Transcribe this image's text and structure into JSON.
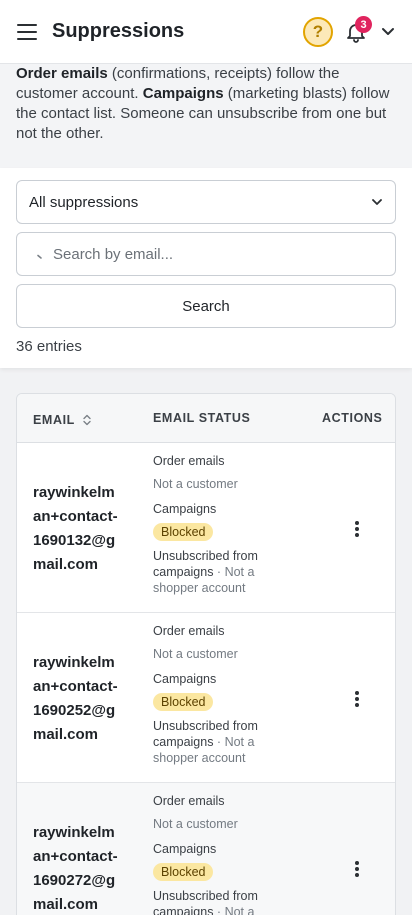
{
  "header": {
    "title": "Suppressions",
    "help_label": "?",
    "notification_count": "3",
    "icons": [
      "menu-icon",
      "help-icon",
      "bell-icon",
      "chevron-down-icon"
    ]
  },
  "intro": {
    "order_emails": "Order emails",
    "order_emails_desc": " (confirmations, receipts) follow the customer account. ",
    "campaigns": "Campaigns",
    "campaigns_desc": " (marketing blasts) follow the contact list. Someone can unsubscribe from one but not the other."
  },
  "filters": {
    "select_value": "All suppressions",
    "search_placeholder": "Search by email...",
    "search_button": "Search",
    "entries": "36 entries"
  },
  "table": {
    "columns": {
      "email": "EMAIL",
      "status": "EMAIL STATUS",
      "actions": "ACTIONS"
    },
    "rows": [
      {
        "email": "raywinkelman+contact-1690132@gmail.com",
        "order_label": "Order emails",
        "order_status": "Not a customer",
        "campaigns_label": "Campaigns",
        "campaigns_badge": "Blocked",
        "unsub_main": "Unsubscribed from campaigns",
        "unsub_sep": " · ",
        "unsub_note": "Not a shopper account"
      },
      {
        "email": "raywinkelman+contact-1690252@gmail.com",
        "order_label": "Order emails",
        "order_status": "Not a customer",
        "campaigns_label": "Campaigns",
        "campaigns_badge": "Blocked",
        "unsub_main": "Unsubscribed from campaigns",
        "unsub_sep": " · ",
        "unsub_note": "Not a shopper account"
      },
      {
        "email": "raywinkelman+contact-1690272@gmail.com",
        "order_label": "Order emails",
        "order_status": "Not a customer",
        "campaigns_label": "Campaigns",
        "campaigns_badge": "Blocked",
        "unsub_main": "Unsubscribed from campaigns",
        "unsub_sep": " · ",
        "unsub_note": "Not a shopper account"
      }
    ]
  },
  "colors": {
    "accent_help": "#e2a400",
    "badge_red": "#e0245e",
    "blocked_pill": "#fbe7a1"
  }
}
